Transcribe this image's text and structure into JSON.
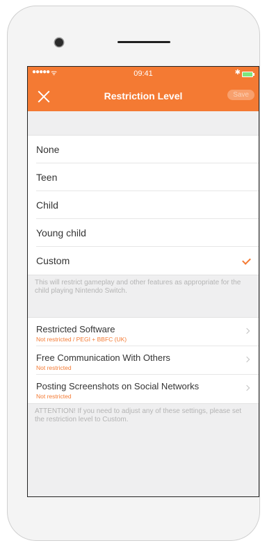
{
  "status_bar": {
    "signal": "●●●●●",
    "wifi": "ᯤ",
    "time": "09:41",
    "bluetooth": "✱"
  },
  "header": {
    "title": "Restriction Level",
    "save_label": "Save"
  },
  "restriction_levels": {
    "items": [
      {
        "label": "None"
      },
      {
        "label": "Teen"
      },
      {
        "label": "Child"
      },
      {
        "label": "Young child"
      },
      {
        "label": "Custom",
        "selected": true
      }
    ]
  },
  "description": "This will restrict gameplay and other features as appropriate for the child playing Nintendo Switch.",
  "settings": {
    "items": [
      {
        "label": "Restricted Software",
        "sub": "Not restricted / PEGI + BBFC (UK)"
      },
      {
        "label": "Free Communication With Others",
        "sub": "Not restricted"
      },
      {
        "label": "Posting Screenshots on Social Networks",
        "sub": "Not restricted"
      }
    ]
  },
  "attention": "ATTENTION! If you need to adjust any of these settings, please set the restriction level to Custom.",
  "colors": {
    "accent": "#f47a33",
    "background": "#efeff0"
  }
}
